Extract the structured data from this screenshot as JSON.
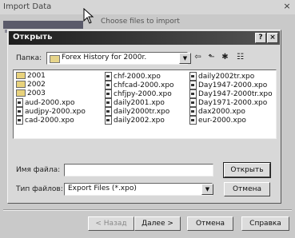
{
  "outer_window": {
    "title": "Import Data",
    "hint": "Choose files to import",
    "close": "×",
    "buttons": {
      "back": "< Назад",
      "next": "Далее >",
      "cancel": "Отмена",
      "help": "Справка"
    }
  },
  "dialog": {
    "title": "Открыть",
    "help_btn": "?",
    "close_btn": "×",
    "look_in_label": "Папка:",
    "look_in_value": "Forex History for 2000r.",
    "toolbar": {
      "back": "⇦",
      "up": "⬑",
      "new_folder": "✱",
      "view": "☷"
    },
    "files": [
      [
        {
          "name": "2001",
          "type": "folder"
        },
        {
          "name": "2002",
          "type": "folder"
        },
        {
          "name": "2003",
          "type": "folder"
        },
        {
          "name": "aud-2000.xpo",
          "type": "file"
        },
        {
          "name": "audjpy-2000.xpo",
          "type": "file"
        },
        {
          "name": "cad-2000.xpo",
          "type": "file"
        }
      ],
      [
        {
          "name": "chf-2000.xpo",
          "type": "file"
        },
        {
          "name": "chfcad-2000.xpo",
          "type": "file"
        },
        {
          "name": "chfjpy-2000.xpo",
          "type": "file"
        },
        {
          "name": "daily2001.xpo",
          "type": "file"
        },
        {
          "name": "daily2000tr.xpo",
          "type": "file"
        },
        {
          "name": "daily2002.xpo",
          "type": "file"
        }
      ],
      [
        {
          "name": "daily2002tr.xpo",
          "type": "file"
        },
        {
          "name": "Day1947-2000.xpo",
          "type": "file"
        },
        {
          "name": "Day1947-2000tr.xpo",
          "type": "file"
        },
        {
          "name": "Day1971-2000.xpo",
          "type": "file"
        },
        {
          "name": "dax2000.xpo",
          "type": "file"
        },
        {
          "name": "eur-2000.xpo",
          "type": "file"
        }
      ]
    ],
    "filename_label": "Имя файла:",
    "filename_value": "",
    "filetype_label": "Тип файлов:",
    "filetype_value": "Export Files (*.xpo)",
    "open_btn": "Открыть",
    "cancel_btn": "Отмена"
  }
}
